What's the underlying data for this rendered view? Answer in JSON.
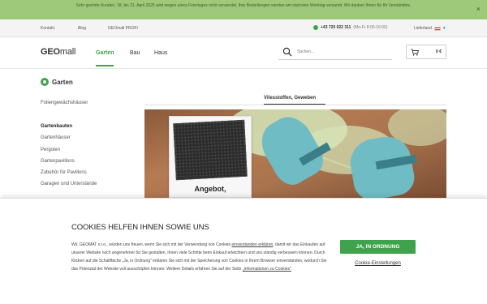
{
  "notice": {
    "text": "Sehr geehrte Kunden, 18. bis 21. April 2025 wird wegen eines Feiertages nicht versendet. Ihre Bestellungen werden am nächsten Werktag versandt. Wir danken Ihnen für Ihr Verständnis.",
    "close_glyph": "×"
  },
  "topbar": {
    "links": [
      "Kontakt",
      "Blog",
      "GEOmall PROFI"
    ],
    "phone": "+43 720 022 311",
    "hours": "(Mo-Fr 8:00-16:00)",
    "country_label": "Lieferland"
  },
  "header": {
    "logo_prefix": "GEO",
    "logo_suffix": "mall",
    "nav": [
      "Garten",
      "Bau",
      "Haus"
    ],
    "search_placeholder": "Suchen...",
    "cart_total": "0 €"
  },
  "sidebar": {
    "title": "Garten",
    "items": [
      "Foliengewächshäuser",
      "Gartenbauten",
      "Gartenhäuser",
      "Pergolen",
      "Gartenpavillons",
      "Zubehör für Pavillons",
      "Garagen und Unterstände"
    ]
  },
  "content": {
    "tab": "Vliesstoffen, Geweben",
    "card_title": "Angebot,"
  },
  "cookie": {
    "title": "COOKIES HELFEN IHNEN SOWIE UNS",
    "text_1": "Wir, GEOMAT s.r.o., würden uns freuen, wenn Sie sich mit der Verwendung von Cookies ",
    "link_1": "einverstanden erklären",
    "text_2": ", damit wir das Einkaufen auf unserer Website noch angenehmer für Sie gestalten, Ihnen viele Schritte beim Einkauf erleichtern und uns ständig verbessern können. Durch Klicken auf die Schaltfläche „Ja, in Ordnung\" erklären Sie sich mit der Speicherung von Cookies in Ihrem Browser einverstanden, wodurch Sie das Potenzial der Website voll ausschöpfen können. Weitere Details erfahren Sie auf der Seite ",
    "link_2": "„Informationen zu Cookies\"",
    "text_3": ".",
    "accept_label": "JA, IN ORDNUNG",
    "settings_label": "Cookie-Einstellungen"
  },
  "colors": {
    "accent": "#3fa34d",
    "notice_bg": "#9fc97a"
  }
}
